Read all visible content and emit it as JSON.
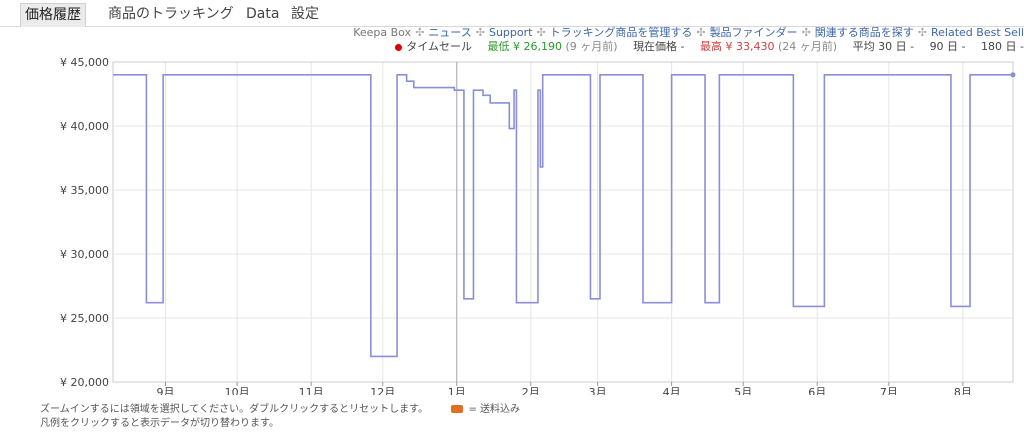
{
  "tabs": [
    "価格履歴",
    "商品のトラッキング",
    "Data",
    "設定"
  ],
  "links": [
    "Keepa Box",
    "ニュース",
    "Support",
    "トラッキング商品を管理する",
    "製品ファインダー",
    "関連する商品を探す",
    "Related Best Sell"
  ],
  "legend": {
    "lightning": "タイムセール",
    "lowest_label": "最低",
    "lowest_value": "¥ 26,190",
    "lowest_ago": "(9 ヶ月前)",
    "current_label": "現在価格 -",
    "highest_label": "最高",
    "highest_value": "¥ 33,430",
    "highest_ago": "(24 ヶ月前)",
    "avg": "平均 30 日 -",
    "avg90": "90 日 -",
    "avg180": "180 日 -"
  },
  "footer": {
    "line1": "ズームインするには領域を選択してください。ダブルクリックするとリセットします。",
    "ship": "= 送料込み",
    "line2": "凡例をクリックすると表示データが切り替わります。"
  },
  "colors": {
    "series": "#8b8fd8",
    "grid": "#e6e6e6",
    "axis": "#999999"
  },
  "chart_data": {
    "type": "line",
    "ylim": [
      20000,
      45000
    ],
    "yticks": [
      {
        "v": 20000,
        "label": "¥ 20,000"
      },
      {
        "v": 25000,
        "label": "¥ 25,000"
      },
      {
        "v": 30000,
        "label": "¥ 30,000"
      },
      {
        "v": 35000,
        "label": "¥ 35,000"
      },
      {
        "v": 40000,
        "label": "¥ 40,000"
      },
      {
        "v": 45000,
        "label": "¥ 45,000"
      }
    ],
    "xlim": [
      "2022-08-10",
      "2023-08-22"
    ],
    "xticks": [
      {
        "d": "2022-09-01",
        "label": "9月"
      },
      {
        "d": "2022-10-01",
        "label": "10月"
      },
      {
        "d": "2022-11-01",
        "label": "11月"
      },
      {
        "d": "2022-12-01",
        "label": "12月"
      },
      {
        "d": "2023-01-01",
        "label": "1月"
      },
      {
        "d": "2023-02-01",
        "label": "2月"
      },
      {
        "d": "2023-03-01",
        "label": "3月"
      },
      {
        "d": "2023-04-01",
        "label": "4月"
      },
      {
        "d": "2023-05-01",
        "label": "5月"
      },
      {
        "d": "2023-06-01",
        "label": "6月"
      },
      {
        "d": "2023-07-01",
        "label": "7月"
      },
      {
        "d": "2023-08-01",
        "label": "8月"
      }
    ],
    "series": [
      {
        "steps": [
          [
            "2022-08-10",
            44000
          ],
          [
            "2022-08-24",
            26200
          ],
          [
            "2022-08-31",
            44000
          ],
          [
            "2022-11-26",
            22000
          ],
          [
            "2022-12-07",
            44000
          ],
          [
            "2022-12-11",
            43500
          ],
          [
            "2022-12-14",
            43000
          ],
          [
            "2022-12-31",
            42800
          ],
          [
            "2023-01-04",
            26500
          ],
          [
            "2023-01-08",
            42800
          ],
          [
            "2023-01-12",
            42400
          ],
          [
            "2023-01-15",
            41800
          ],
          [
            "2023-01-23",
            39800
          ],
          [
            "2023-01-25",
            42800
          ],
          [
            "2023-01-26",
            26200
          ],
          [
            "2023-02-04",
            42800
          ],
          [
            "2023-02-05",
            36800
          ],
          [
            "2023-02-06",
            44000
          ],
          [
            "2023-02-26",
            26500
          ],
          [
            "2023-03-02",
            44000
          ],
          [
            "2023-03-20",
            26200
          ],
          [
            "2023-04-01",
            44000
          ],
          [
            "2023-04-15",
            26200
          ],
          [
            "2023-04-21",
            44000
          ],
          [
            "2023-05-22",
            25900
          ],
          [
            "2023-06-04",
            44000
          ],
          [
            "2023-07-27",
            25900
          ],
          [
            "2023-08-04",
            44000
          ]
        ],
        "end": [
          "2023-08-22",
          44000
        ]
      }
    ]
  }
}
